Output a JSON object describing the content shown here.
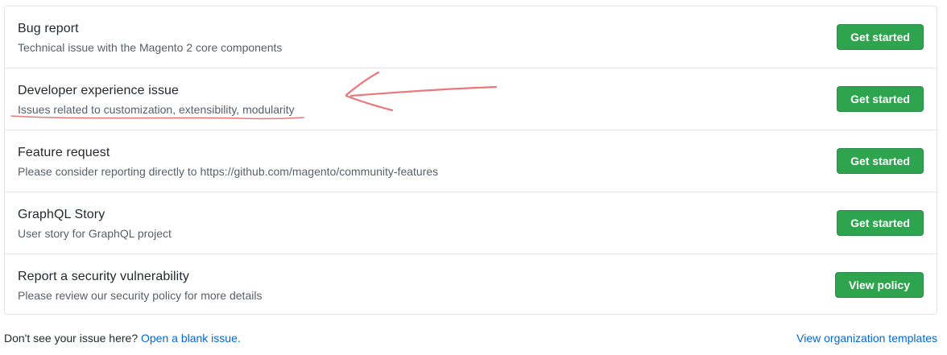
{
  "templates": [
    {
      "title": "Bug report",
      "description": "Technical issue with the Magento 2 core components",
      "button_label": "Get started"
    },
    {
      "title": "Developer experience issue",
      "description": "Issues related to customization, extensibility, modularity",
      "button_label": "Get started"
    },
    {
      "title": "Feature request",
      "description": "Please consider reporting directly to https://github.com/magento/community-features",
      "button_label": "Get started"
    },
    {
      "title": "GraphQL Story",
      "description": "User story for GraphQL project",
      "button_label": "Get started"
    },
    {
      "title": "Report a security vulnerability",
      "description": "Please review our security policy for more details",
      "button_label": "View policy"
    }
  ],
  "footer": {
    "prompt_text": "Don't see your issue here? ",
    "blank_issue_link": "Open a blank issue.",
    "org_templates_link": "View organization templates"
  },
  "colors": {
    "button_green": "#2ea44f",
    "link_blue": "#0366d6",
    "annotation_red": "#e8696b"
  }
}
